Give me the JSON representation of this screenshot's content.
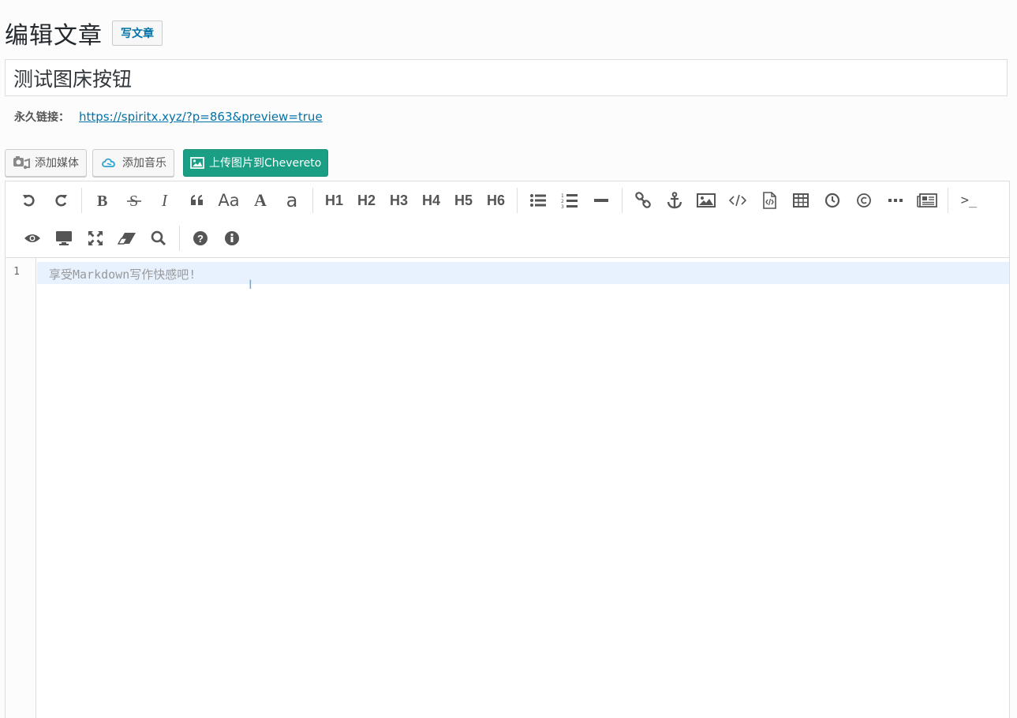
{
  "header": {
    "title": "编辑文章",
    "action_label": "写文章"
  },
  "post": {
    "title": "测试图床按钮",
    "permalink_label": "永久链接：",
    "permalink_url": "https://spiritx.xyz/?p=863&preview=true"
  },
  "media_buttons": {
    "add_media": "添加媒体",
    "add_music": "添加音乐",
    "upload_chevereto": "上传图片到Chevereto"
  },
  "toolbar": {
    "headings": [
      "H1",
      "H2",
      "H3",
      "H4",
      "H5",
      "H6"
    ],
    "case_label": "Aa",
    "upper_label": "A",
    "lower_label": "a",
    "terminal_label": ">_"
  },
  "editor": {
    "line_number": "1",
    "placeholder": "享受Markdown写作快感吧!"
  },
  "colors": {
    "accent": "#0073aa",
    "chevereto_button": "#1a9f84",
    "active_line": "#e8f2fe"
  }
}
